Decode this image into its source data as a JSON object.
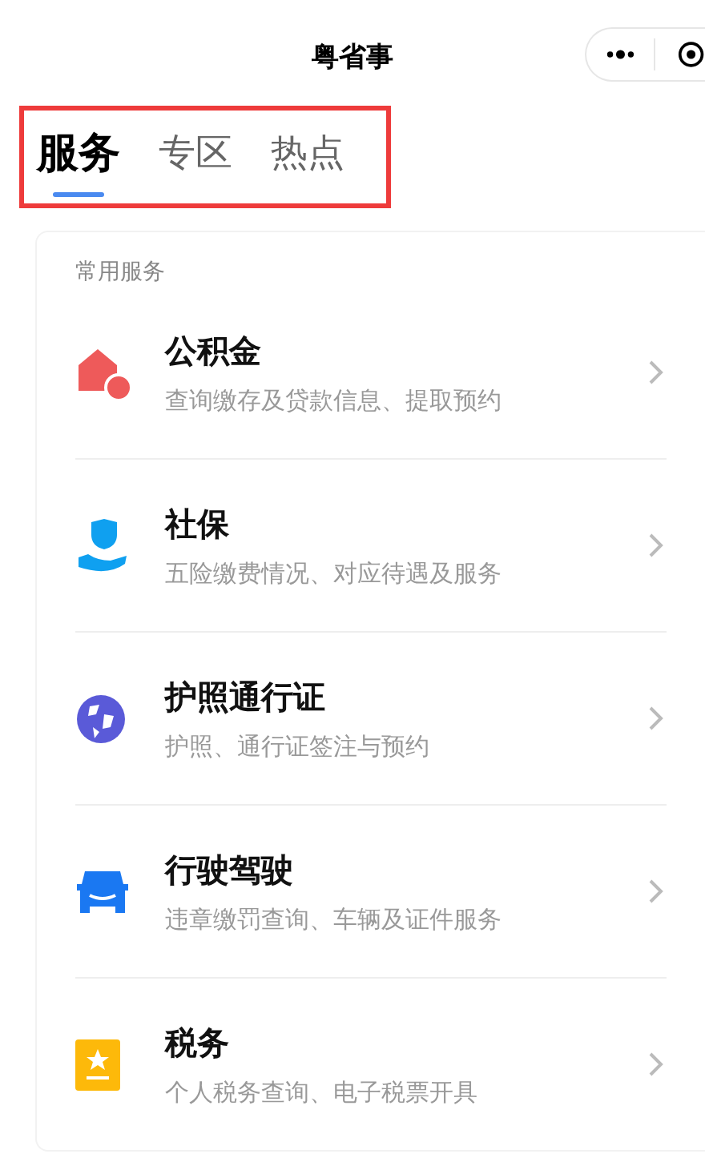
{
  "window": {
    "title": "粤省事"
  },
  "tabs": [
    {
      "label": "服务",
      "selected": true
    },
    {
      "label": "专区",
      "selected": false
    },
    {
      "label": "热点",
      "selected": false
    }
  ],
  "section": {
    "title": "常用服务"
  },
  "services": [
    {
      "kind": "house",
      "title": "公积金",
      "subtitle": "查询缴存及贷款信息、提取预约"
    },
    {
      "kind": "hand",
      "title": "社保",
      "subtitle": "五险缴费情况、对应待遇及服务"
    },
    {
      "kind": "globe",
      "title": "护照通行证",
      "subtitle": "护照、通行证签注与预约"
    },
    {
      "kind": "car",
      "title": "行驶驾驶",
      "subtitle": "违章缴罚查询、车辆及证件服务"
    },
    {
      "kind": "badge",
      "title": "税务",
      "subtitle": "个人税务查询、电子税票开具"
    }
  ]
}
